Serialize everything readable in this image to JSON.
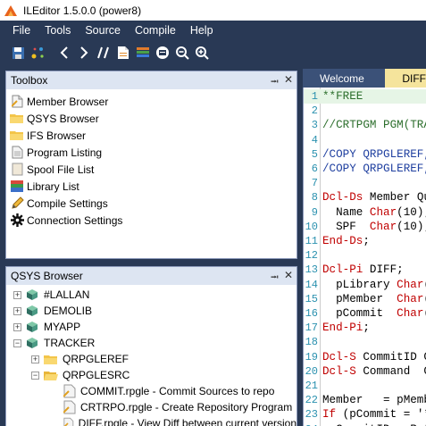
{
  "window": {
    "title": "ILEditor 1.5.0.0 (power8)"
  },
  "menu": [
    "File",
    "Tools",
    "Source",
    "Compile",
    "Help"
  ],
  "toolbar": [
    "save-icon",
    "connect-icon",
    "back-icon",
    "forward-icon",
    "comment-icon",
    "new-member-icon",
    "library-icon",
    "print-icon",
    "zoom-out-icon",
    "zoom-in-icon"
  ],
  "toolbox": {
    "title": "Toolbox",
    "items": [
      {
        "label": "Member Browser",
        "icon": "document-icon"
      },
      {
        "label": "QSYS Browser",
        "icon": "folder-icon"
      },
      {
        "label": "IFS Browser",
        "icon": "folder-icon"
      },
      {
        "label": "Program Listing",
        "icon": "listing-icon"
      },
      {
        "label": "Spool File List",
        "icon": "spool-icon"
      },
      {
        "label": "Library List",
        "icon": "books-icon"
      },
      {
        "label": "Compile Settings",
        "icon": "pencil-icon"
      },
      {
        "label": "Connection Settings",
        "icon": "gear-icon"
      }
    ]
  },
  "qsys": {
    "title": "QSYS Browser",
    "libraries": [
      "#LALLAN",
      "DEMOLIB",
      "MYAPP",
      "TRACKER"
    ],
    "files": [
      "QRPGLEREF",
      "QRPGLESRC"
    ],
    "members": [
      "COMMIT.rpgle - Commit Sources to repo",
      "CRTRPO.rpgle - Create Repository Program",
      "DIFF.rpgle - View Diff between current version"
    ]
  },
  "tabs": [
    {
      "label": "Welcome"
    },
    {
      "label": "DIFF"
    }
  ],
  "editor": {
    "lines": [
      {
        "n": "1",
        "code": "**FREE"
      },
      {
        "n": "2",
        "code": ""
      },
      {
        "n": "3",
        "code": "//CRTPGM PGM(TRA"
      },
      {
        "n": "4",
        "code": ""
      },
      {
        "n": "5",
        "code": "/COPY QRPGLEREF,"
      },
      {
        "n": "6",
        "code": "/COPY QRPGLEREF,"
      },
      {
        "n": "7",
        "code": ""
      },
      {
        "n": "8",
        "code": "Dcl-Ds Member Qu"
      },
      {
        "n": "9",
        "code": "  Name Char(10);"
      },
      {
        "n": "10",
        "code": "  SPF  Char(10);"
      },
      {
        "n": "11",
        "code": "End-Ds;"
      },
      {
        "n": "12",
        "code": ""
      },
      {
        "n": "13",
        "code": "Dcl-Pi DIFF;"
      },
      {
        "n": "14",
        "code": "  pLibrary Char("
      },
      {
        "n": "15",
        "code": "  pMember  Char("
      },
      {
        "n": "16",
        "code": "  pCommit  Char("
      },
      {
        "n": "17",
        "code": "End-Pi;"
      },
      {
        "n": "18",
        "code": ""
      },
      {
        "n": "19",
        "code": "Dcl-S CommitID C"
      },
      {
        "n": "20",
        "code": "Dcl-S Command  C"
      },
      {
        "n": "21",
        "code": ""
      },
      {
        "n": "22",
        "code": "Member   = pMemb"
      },
      {
        "n": "23",
        "code": "If (pCommit = '*"
      },
      {
        "n": "24",
        "code": "  CommitID = Ret"
      }
    ]
  },
  "colors": {
    "frame": "#293955",
    "panel_title": "#dde5f2",
    "tab_active": "#f5e49c",
    "tab_inactive": "#3b5178"
  }
}
